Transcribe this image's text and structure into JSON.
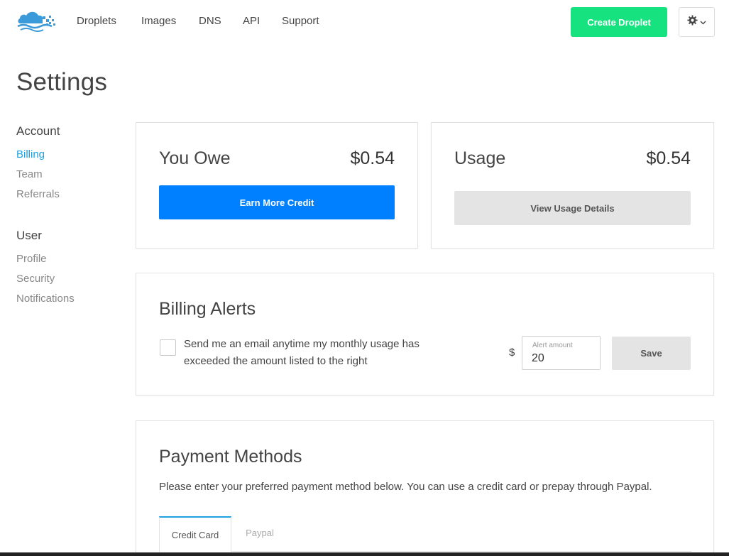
{
  "nav": {
    "links": [
      "Droplets",
      "Images",
      "DNS",
      "API",
      "Support"
    ],
    "create_button": "Create Droplet",
    "settings_icon": "gear-icon",
    "accent_color": "#16e27f"
  },
  "page": {
    "title": "Settings"
  },
  "sidebar": {
    "sections": [
      {
        "heading": "Account",
        "items": [
          "Billing",
          "Team",
          "Referrals"
        ]
      },
      {
        "heading": "User",
        "items": [
          "Profile",
          "Security",
          "Notifications"
        ]
      }
    ],
    "active_item": "Billing"
  },
  "owe_card": {
    "title": "You Owe",
    "amount": "$0.54",
    "button": "Earn More Credit"
  },
  "usage_card": {
    "title": "Usage",
    "amount": "$0.54",
    "button": "View Usage Details"
  },
  "billing_alerts": {
    "title": "Billing Alerts",
    "checkbox_label": "Send me an email anytime my monthly usage has exceeded the amount listed to the right",
    "checked": false,
    "currency": "$",
    "field_label": "Alert amount",
    "field_value": "20",
    "save_button": "Save"
  },
  "payment_methods": {
    "title": "Payment Methods",
    "description": "Please enter your preferred payment method below. You can use a credit card or prepay through Paypal.",
    "tabs": [
      "Credit Card",
      "Paypal"
    ],
    "active_tab": "Credit Card"
  },
  "colors": {
    "primary": "#0080ff",
    "link_active": "#1fa0e0",
    "success": "#16e27f"
  }
}
